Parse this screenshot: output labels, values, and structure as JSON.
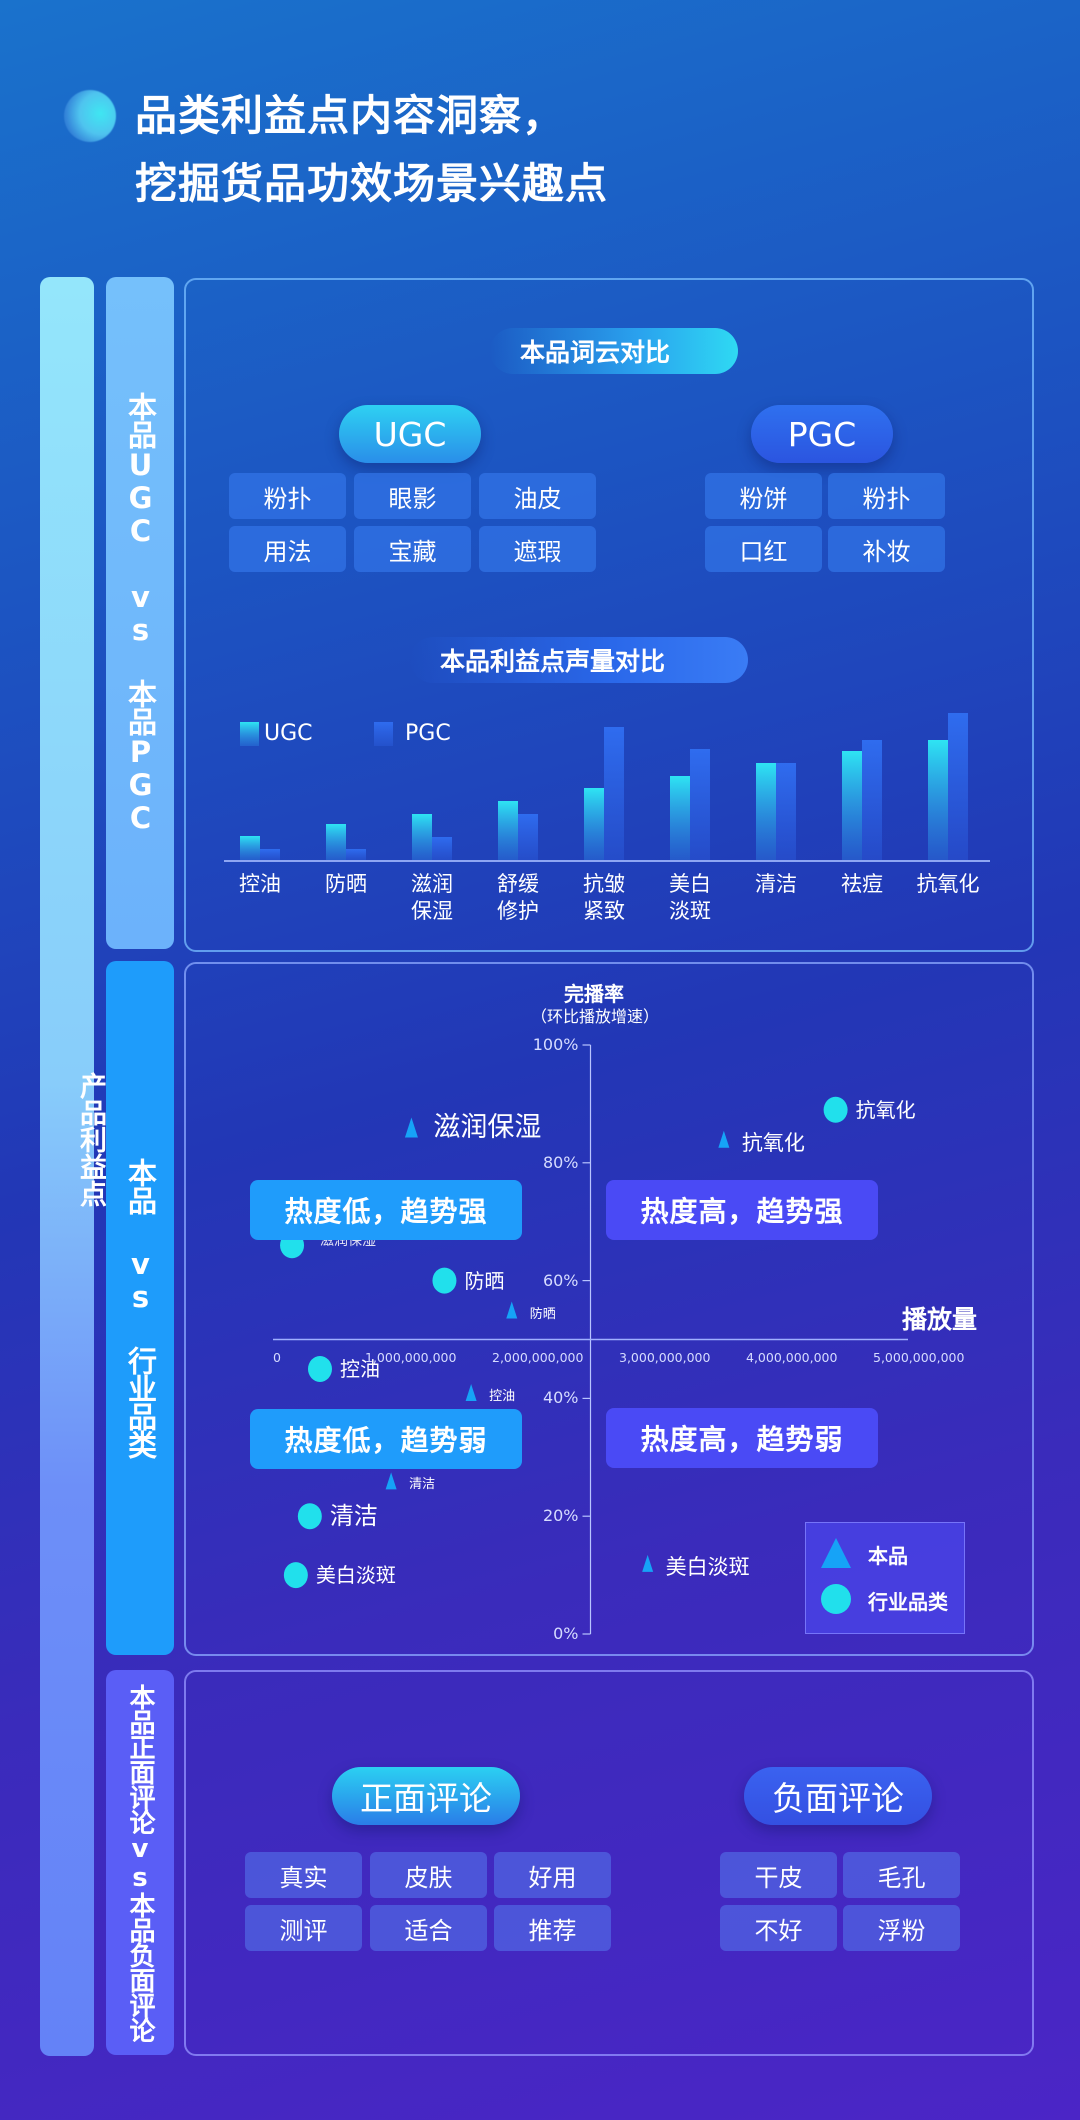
{
  "header": {
    "title_line1": "品类利益点内容洞察，",
    "title_line2": "挖掘货品功效场景兴趣点"
  },
  "rails": {
    "outer_label": "产品利益点",
    "section1_label": "本品UGC vs 本品PGC",
    "section2_label": "本品 vs 行业品类",
    "section3_label": "本品正面评论vs本品负面评论"
  },
  "wordcloud": {
    "title": "本品词云对比",
    "ugc": {
      "label": "UGC",
      "tags": [
        "粉扑",
        "眼影",
        "油皮",
        "用法",
        "宝藏",
        "遮瑕"
      ]
    },
    "pgc": {
      "label": "PGC",
      "tags": [
        "粉饼",
        "粉扑",
        "口红",
        "补妆"
      ]
    }
  },
  "comments": {
    "positive": {
      "label": "正面评论",
      "tags": [
        "真实",
        "皮肤",
        "好用",
        "测评",
        "适合",
        "推荐"
      ]
    },
    "negative": {
      "label": "负面评论",
      "tags": [
        "干皮",
        "毛孔",
        "不好",
        "浮粉"
      ]
    }
  },
  "colors": {
    "ugc_top": "#2ee0f2",
    "pgc_top": "#2f6cef",
    "brand_marker": "#16a3f7",
    "industry_marker": "#21e0ec",
    "quad_low": "#1f9cfb",
    "quad_high": "#4a4af5"
  },
  "chart_data": [
    {
      "type": "bar",
      "title": "本品利益点声量对比",
      "categories": [
        "控油",
        "防晒",
        "滋润保湿",
        "舒缓修护",
        "抗皱紧致",
        "美白淡斑",
        "清洁",
        "祛痘",
        "抗氧化"
      ],
      "category_lines": [
        [
          "控油"
        ],
        [
          "防晒"
        ],
        [
          "滋润",
          "保湿"
        ],
        [
          "舒缓",
          "修护"
        ],
        [
          "抗皱",
          "紧致"
        ],
        [
          "美白",
          "淡斑"
        ],
        [
          "清洁"
        ],
        [
          "祛痘"
        ],
        [
          "抗氧化"
        ]
      ],
      "series": [
        {
          "name": "UGC",
          "values": [
            24,
            36,
            46,
            59,
            72,
            84,
            97,
            109,
            120
          ]
        },
        {
          "name": "PGC",
          "values": [
            11,
            11,
            23,
            46,
            133,
            111,
            97,
            120,
            147
          ]
        }
      ],
      "xlabel": "",
      "ylabel": "",
      "ylim": [
        0,
        150
      ],
      "value_unit": "relative (no axis shown)",
      "legend": "top-left",
      "grid": false
    },
    {
      "type": "scatter",
      "title": "",
      "ylabel": "完播率",
      "ylabel_sub": "（环比播放增速）",
      "xlabel": "播放量",
      "xlim": [
        0,
        5000000000
      ],
      "ylim": [
        0,
        100
      ],
      "x_ticks": [
        "0",
        "1,000,000,000",
        "2,000,000,000",
        "3,000,000,000",
        "4,000,000,000",
        "5,000,000,000"
      ],
      "x_tick_values": [
        0,
        1000000000,
        2000000000,
        3000000000,
        4000000000,
        5000000000
      ],
      "y_ticks": [
        "0%",
        "20%",
        "40%",
        "60%",
        "80%",
        "100%"
      ],
      "y_tick_values": [
        0,
        20,
        40,
        60,
        80,
        100
      ],
      "x_cross": 2500000000,
      "y_cross": 50,
      "quadrants": {
        "top_left": "热度低，趋势强",
        "top_right": "热度高，趋势强",
        "bottom_left": "热度低，趋势弱",
        "bottom_right": "热度高，趋势弱"
      },
      "legend": {
        "position": "bottom-right",
        "entries": [
          {
            "name": "本品",
            "marker": "triangle"
          },
          {
            "name": "行业品类",
            "marker": "circle"
          }
        ]
      },
      "series": [
        {
          "name": "本品",
          "marker": "triangle",
          "points": [
            {
              "label": "滋润保湿",
              "x": 1090000000,
              "y": 86,
              "big": true
            },
            {
              "label": "抗氧化",
              "x": 3550000000,
              "y": 84,
              "big": false
            },
            {
              "label": "防晒",
              "x": 1880000000,
              "y": 55,
              "big": false,
              "small": true
            },
            {
              "label": "控油",
              "x": 1560000000,
              "y": 41,
              "big": false,
              "small": true
            },
            {
              "label": "清洁",
              "x": 930000000,
              "y": 26,
              "big": false,
              "small": true
            },
            {
              "label": "美白淡斑",
              "x": 2950000000,
              "y": 12,
              "big": false
            }
          ]
        },
        {
          "name": "行业品类",
          "marker": "circle",
          "points": [
            {
              "label": "抗氧化",
              "x": 4430000000,
              "y": 89
            },
            {
              "label": "滋润保湿",
              "x": 150000000,
              "y": 66,
              "small": true
            },
            {
              "label": "防晒",
              "x": 1350000000,
              "y": 60
            },
            {
              "label": "控油",
              "x": 370000000,
              "y": 45
            },
            {
              "label": "清洁",
              "x": 290000000,
              "y": 20,
              "big": true
            },
            {
              "label": "美白淡斑",
              "x": 180000000,
              "y": 10
            }
          ]
        }
      ]
    }
  ]
}
